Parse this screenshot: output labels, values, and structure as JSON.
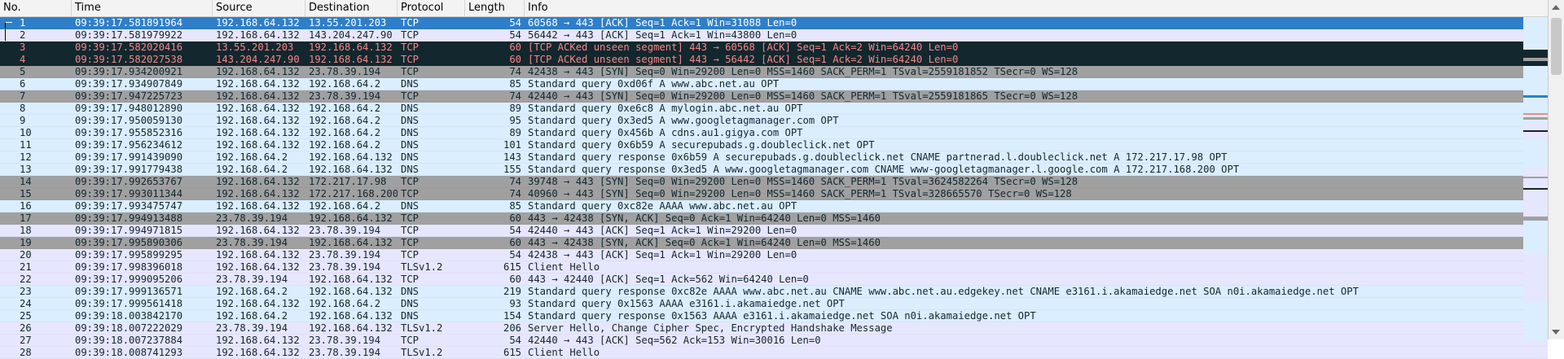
{
  "columns": {
    "no": "No.",
    "time": "Time",
    "source": "Source",
    "destination": "Destination",
    "protocol": "Protocol",
    "length": "Length",
    "info": "Info"
  },
  "colors": {
    "tcp": "#e7e6ff",
    "dns": "#daeeff",
    "syn": "#a0a0a0",
    "bad_bg": "#12272e",
    "bad_fg": "#f78787",
    "selected": "#2f7ec9"
  },
  "packets": [
    {
      "no": "1",
      "time": "09:39:17.581891964",
      "src": "192.168.64.132",
      "dst": "13.55.201.203",
      "proto": "TCP",
      "len": "54",
      "info": "60568 → 443 [ACK] Seq=1 Ack=1 Win=31088 Len=0",
      "style": "selected"
    },
    {
      "no": "2",
      "time": "09:39:17.581979922",
      "src": "192.168.64.132",
      "dst": "143.204.247.90",
      "proto": "TCP",
      "len": "54",
      "info": "56442 → 443 [ACK] Seq=1 Ack=1 Win=43800 Len=0",
      "style": "tcp"
    },
    {
      "no": "3",
      "time": "09:39:17.582020416",
      "src": "13.55.201.203",
      "dst": "192.168.64.132",
      "proto": "TCP",
      "len": "60",
      "info": "[TCP ACKed unseen segment] 443 → 60568 [ACK] Seq=1 Ack=2 Win=64240 Len=0",
      "style": "bad"
    },
    {
      "no": "4",
      "time": "09:39:17.582027538",
      "src": "143.204.247.90",
      "dst": "192.168.64.132",
      "proto": "TCP",
      "len": "60",
      "info": "[TCP ACKed unseen segment] 443 → 56442 [ACK] Seq=1 Ack=2 Win=64240 Len=0",
      "style": "bad"
    },
    {
      "no": "5",
      "time": "09:39:17.934200921",
      "src": "192.168.64.132",
      "dst": "23.78.39.194",
      "proto": "TCP",
      "len": "74",
      "info": "42438 → 443 [SYN] Seq=0 Win=29200 Len=0 MSS=1460 SACK_PERM=1 TSval=2559181852 TSecr=0 WS=128",
      "style": "syn"
    },
    {
      "no": "6",
      "time": "09:39:17.934907849",
      "src": "192.168.64.132",
      "dst": "192.168.64.2",
      "proto": "DNS",
      "len": "85",
      "info": "Standard query 0xd06f A www.abc.net.au OPT",
      "style": "dns"
    },
    {
      "no": "7",
      "time": "09:39:17.947225723",
      "src": "192.168.64.132",
      "dst": "23.78.39.194",
      "proto": "TCP",
      "len": "74",
      "info": "42440 → 443 [SYN] Seq=0 Win=29200 Len=0 MSS=1460 SACK_PERM=1 TSval=2559181865 TSecr=0 WS=128",
      "style": "syn"
    },
    {
      "no": "8",
      "time": "09:39:17.948012890",
      "src": "192.168.64.132",
      "dst": "192.168.64.2",
      "proto": "DNS",
      "len": "89",
      "info": "Standard query 0xe6c8 A mylogin.abc.net.au OPT",
      "style": "dns"
    },
    {
      "no": "9",
      "time": "09:39:17.950059130",
      "src": "192.168.64.132",
      "dst": "192.168.64.2",
      "proto": "DNS",
      "len": "95",
      "info": "Standard query 0x3ed5 A www.googletagmanager.com OPT",
      "style": "dns"
    },
    {
      "no": "10",
      "time": "09:39:17.955852316",
      "src": "192.168.64.132",
      "dst": "192.168.64.2",
      "proto": "DNS",
      "len": "89",
      "info": "Standard query 0x456b A cdns.au1.gigya.com OPT",
      "style": "dns"
    },
    {
      "no": "11",
      "time": "09:39:17.956234612",
      "src": "192.168.64.132",
      "dst": "192.168.64.2",
      "proto": "DNS",
      "len": "101",
      "info": "Standard query 0x6b59 A securepubads.g.doubleclick.net OPT",
      "style": "dns"
    },
    {
      "no": "12",
      "time": "09:39:17.991439090",
      "src": "192.168.64.2",
      "dst": "192.168.64.132",
      "proto": "DNS",
      "len": "143",
      "info": "Standard query response 0x6b59 A securepubads.g.doubleclick.net CNAME partnerad.l.doubleclick.net A 172.217.17.98 OPT",
      "style": "dns"
    },
    {
      "no": "13",
      "time": "09:39:17.991779438",
      "src": "192.168.64.2",
      "dst": "192.168.64.132",
      "proto": "DNS",
      "len": "155",
      "info": "Standard query response 0x3ed5 A www.googletagmanager.com CNAME www-googletagmanager.l.google.com A 172.217.168.200 OPT",
      "style": "dns"
    },
    {
      "no": "14",
      "time": "09:39:17.992653767",
      "src": "192.168.64.132",
      "dst": "172.217.17.98",
      "proto": "TCP",
      "len": "74",
      "info": "39748 → 443 [SYN] Seq=0 Win=29200 Len=0 MSS=1460 SACK_PERM=1 TSval=3624582264 TSecr=0 WS=128",
      "style": "syn"
    },
    {
      "no": "15",
      "time": "09:39:17.993011344",
      "src": "192.168.64.132",
      "dst": "172.217.168.200",
      "proto": "TCP",
      "len": "74",
      "info": "40960 → 443 [SYN] Seq=0 Win=29200 Len=0 MSS=1460 SACK_PERM=1 TSval=328665570 TSecr=0 WS=128",
      "style": "syn"
    },
    {
      "no": "16",
      "time": "09:39:17.993475747",
      "src": "192.168.64.132",
      "dst": "192.168.64.2",
      "proto": "DNS",
      "len": "85",
      "info": "Standard query 0xc82e AAAA www.abc.net.au OPT",
      "style": "dns"
    },
    {
      "no": "17",
      "time": "09:39:17.994913488",
      "src": "23.78.39.194",
      "dst": "192.168.64.132",
      "proto": "TCP",
      "len": "60",
      "info": "443 → 42438 [SYN, ACK] Seq=0 Ack=1 Win=64240 Len=0 MSS=1460",
      "style": "syn"
    },
    {
      "no": "18",
      "time": "09:39:17.994971815",
      "src": "192.168.64.132",
      "dst": "23.78.39.194",
      "proto": "TCP",
      "len": "54",
      "info": "42440 → 443 [ACK] Seq=1 Ack=1 Win=29200 Len=0",
      "style": "tcp"
    },
    {
      "no": "19",
      "time": "09:39:17.995890306",
      "src": "23.78.39.194",
      "dst": "192.168.64.132",
      "proto": "TCP",
      "len": "60",
      "info": "443 → 42438 [SYN, ACK] Seq=0 Ack=1 Win=64240 Len=0 MSS=1460",
      "style": "syn"
    },
    {
      "no": "20",
      "time": "09:39:17.995899295",
      "src": "192.168.64.132",
      "dst": "23.78.39.194",
      "proto": "TCP",
      "len": "54",
      "info": "42438 → 443 [ACK] Seq=1 Ack=1 Win=29200 Len=0",
      "style": "tcp"
    },
    {
      "no": "21",
      "time": "09:39:17.998396018",
      "src": "192.168.64.132",
      "dst": "23.78.39.194",
      "proto": "TLSv1.2",
      "len": "615",
      "info": "Client Hello",
      "style": "tcp"
    },
    {
      "no": "22",
      "time": "09:39:17.999095206",
      "src": "23.78.39.194",
      "dst": "192.168.64.132",
      "proto": "TCP",
      "len": "60",
      "info": "443 → 42440 [ACK] Seq=1 Ack=562 Win=64240 Len=0",
      "style": "tcp"
    },
    {
      "no": "23",
      "time": "09:39:17.999136571",
      "src": "192.168.64.2",
      "dst": "192.168.64.132",
      "proto": "DNS",
      "len": "219",
      "info": "Standard query response 0xc82e AAAA www.abc.net.au CNAME www.abc.net.au.edgekey.net CNAME e3161.i.akamaiedge.net SOA n0i.akamaiedge.net OPT",
      "style": "dns"
    },
    {
      "no": "24",
      "time": "09:39:17.999561418",
      "src": "192.168.64.132",
      "dst": "192.168.64.2",
      "proto": "DNS",
      "len": "93",
      "info": "Standard query 0x1563 AAAA e3161.i.akamaiedge.net OPT",
      "style": "dns"
    },
    {
      "no": "25",
      "time": "09:39:18.003842170",
      "src": "192.168.64.2",
      "dst": "192.168.64.132",
      "proto": "DNS",
      "len": "154",
      "info": "Standard query response 0x1563 AAAA e3161.i.akamaiedge.net SOA n0i.akamaiedge.net OPT",
      "style": "dns"
    },
    {
      "no": "26",
      "time": "09:39:18.007222029",
      "src": "23.78.39.194",
      "dst": "192.168.64.132",
      "proto": "TLSv1.2",
      "len": "206",
      "info": "Server Hello, Change Cipher Spec, Encrypted Handshake Message",
      "style": "tcp"
    },
    {
      "no": "27",
      "time": "09:39:18.007237884",
      "src": "192.168.64.132",
      "dst": "23.78.39.194",
      "proto": "TCP",
      "len": "54",
      "info": "42440 → 443 [ACK] Seq=562 Ack=153 Win=30016 Len=0",
      "style": "tcp"
    },
    {
      "no": "28",
      "time": "09:39:18.008741293",
      "src": "192.168.64.132",
      "dst": "23.78.39.194",
      "proto": "TLSv1.2",
      "len": "615",
      "info": "Client Hello",
      "style": "tcp"
    }
  ]
}
